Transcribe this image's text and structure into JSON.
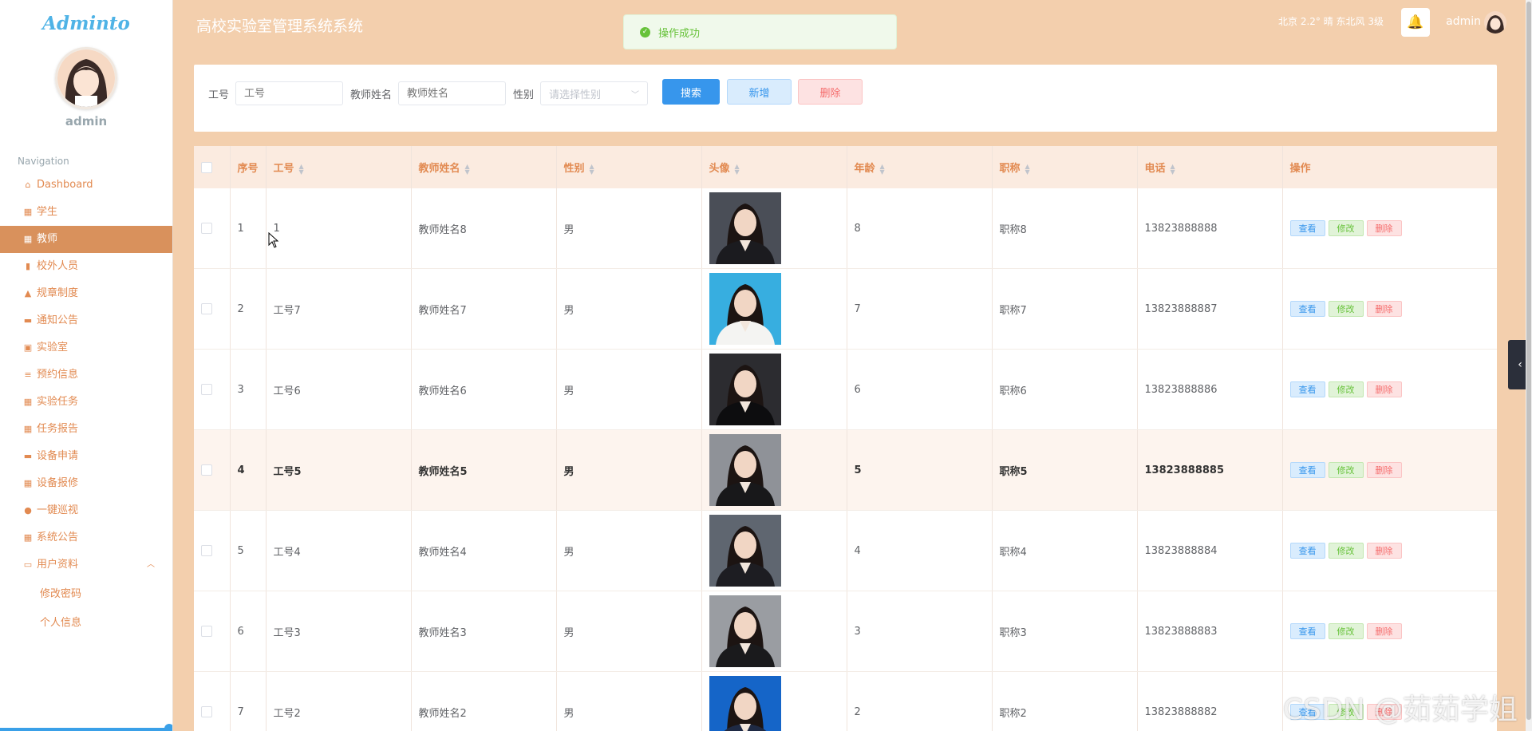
{
  "sidebar": {
    "logo": "Adminto",
    "username": "admin",
    "nav_title": "Navigation",
    "items": [
      {
        "label": "Dashboard",
        "icon": "home-icon"
      },
      {
        "label": "学生",
        "icon": "grid-icon"
      },
      {
        "label": "教师",
        "icon": "grid-icon",
        "active": true
      },
      {
        "label": "校外人员",
        "icon": "bar-chart-icon"
      },
      {
        "label": "规章制度",
        "icon": "thumb-icon"
      },
      {
        "label": "通知公告",
        "icon": "message-icon"
      },
      {
        "label": "实验室",
        "icon": "clipboard-icon"
      },
      {
        "label": "预约信息",
        "icon": "sliders-icon"
      },
      {
        "label": "实验任务",
        "icon": "grid-icon"
      },
      {
        "label": "任务报告",
        "icon": "grid-icon"
      },
      {
        "label": "设备申请",
        "icon": "ticket-icon"
      },
      {
        "label": "设备报修",
        "icon": "grid-icon"
      },
      {
        "label": "一键巡视",
        "icon": "user-icon"
      },
      {
        "label": "系统公告",
        "icon": "grid-icon"
      },
      {
        "label": "用户资料",
        "icon": "calendar-icon",
        "expanded": true
      }
    ],
    "subitems": [
      {
        "label": "修改密码"
      },
      {
        "label": "个人信息"
      }
    ]
  },
  "header": {
    "title": "高校实验室管理系统系统",
    "weather": "北京  2.2°  晴  东北风  3级",
    "username": "admin"
  },
  "toast": {
    "message": "操作成功"
  },
  "search": {
    "id_label": "工号",
    "id_placeholder": "工号",
    "name_label": "教师姓名",
    "name_placeholder": "教师姓名",
    "gender_label": "性别",
    "gender_placeholder": "请选择性别",
    "search_button": "搜索",
    "add_button": "新增",
    "delete_button": "删除"
  },
  "table": {
    "columns": [
      "序号",
      "工号",
      "教师姓名",
      "性别",
      "头像",
      "年龄",
      "职称",
      "电话",
      "操作"
    ],
    "actions": {
      "view": "查看",
      "edit": "修改",
      "delete": "删除"
    },
    "rows": [
      {
        "index": "1",
        "id": "1",
        "name": "教师姓名8",
        "gender": "男",
        "age": "8",
        "title": "职称8",
        "phone": "13823888888",
        "photo_bg": "#4a4e57",
        "photo_shirt": "#1b1b1f"
      },
      {
        "index": "2",
        "id": "工号7",
        "name": "教师姓名7",
        "gender": "男",
        "age": "7",
        "title": "职称7",
        "phone": "13823888887",
        "photo_bg": "#37aee0",
        "photo_shirt": "#f4f4f2"
      },
      {
        "index": "3",
        "id": "工号6",
        "name": "教师姓名6",
        "gender": "男",
        "age": "6",
        "title": "职称6",
        "phone": "13823888886",
        "photo_bg": "#2c2c30",
        "photo_shirt": "#0d0d0f"
      },
      {
        "index": "4",
        "id": "工号5",
        "name": "教师姓名5",
        "gender": "男",
        "age": "5",
        "title": "职称5",
        "phone": "13823888885",
        "photo_bg": "#8f9298",
        "photo_shirt": "#18181a",
        "highlight": true
      },
      {
        "index": "5",
        "id": "工号4",
        "name": "教师姓名4",
        "gender": "男",
        "age": "4",
        "title": "职称4",
        "phone": "13823888884",
        "photo_bg": "#5f6670",
        "photo_shirt": "#1d1d22"
      },
      {
        "index": "6",
        "id": "工号3",
        "name": "教师姓名3",
        "gender": "男",
        "age": "3",
        "title": "职称3",
        "phone": "13823888883",
        "photo_bg": "#9a9da2",
        "photo_shirt": "#1a1a1c"
      },
      {
        "index": "7",
        "id": "工号2",
        "name": "教师姓名2",
        "gender": "男",
        "age": "2",
        "title": "职称2",
        "phone": "13823888882",
        "photo_bg": "#1565c8",
        "photo_shirt": "#1f2a44"
      }
    ]
  },
  "watermark": "CSDN @茹茹学姐"
}
